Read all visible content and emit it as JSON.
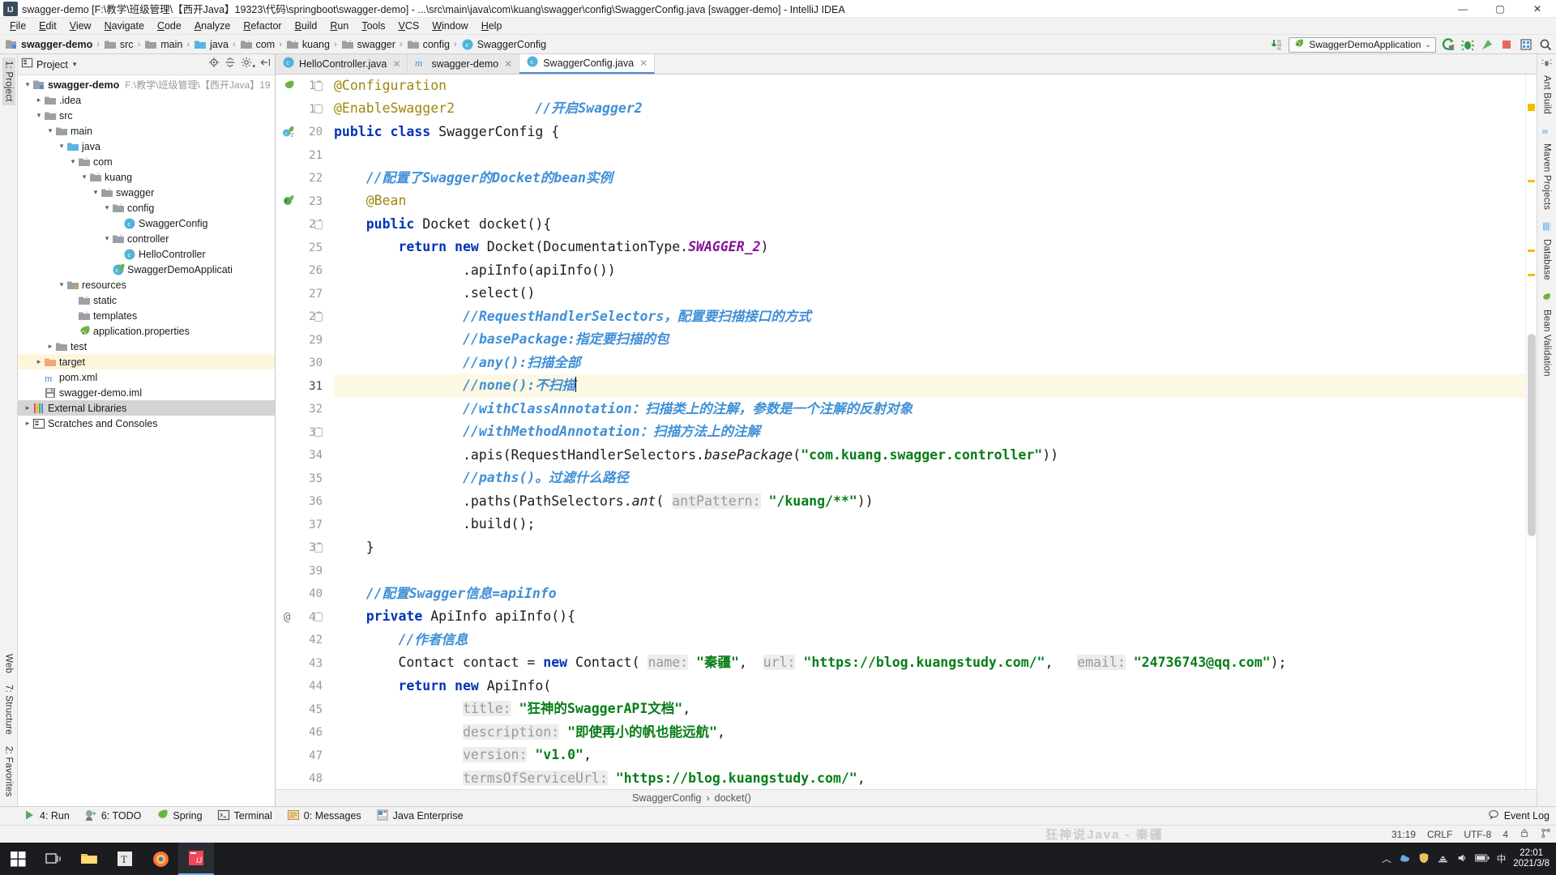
{
  "window": {
    "title": "swagger-demo [F:\\教学\\班级管理\\【西开Java】19323\\代码\\springboot\\swagger-demo] - ...\\src\\main\\java\\com\\kuang\\swagger\\config\\SwaggerConfig.java [swagger-demo] - IntelliJ IDEA",
    "app_icon": "IJ",
    "minimize": "—",
    "maximize": "▢",
    "close": "✕"
  },
  "menubar": {
    "items": [
      "File",
      "Edit",
      "View",
      "Navigate",
      "Code",
      "Analyze",
      "Refactor",
      "Build",
      "Run",
      "Tools",
      "VCS",
      "Window",
      "Help"
    ]
  },
  "navbar": {
    "breadcrumbs": [
      {
        "label": "swagger-demo",
        "icon": "module-icon",
        "bold": true
      },
      {
        "label": "src",
        "icon": "folder-icon",
        "bold": false
      },
      {
        "label": "main",
        "icon": "folder-icon",
        "bold": false
      },
      {
        "label": "java",
        "icon": "source-folder-icon",
        "bold": false
      },
      {
        "label": "com",
        "icon": "package-icon",
        "bold": false
      },
      {
        "label": "kuang",
        "icon": "package-icon",
        "bold": false
      },
      {
        "label": "swagger",
        "icon": "package-icon",
        "bold": false
      },
      {
        "label": "config",
        "icon": "package-icon",
        "bold": false
      },
      {
        "label": "SwaggerConfig",
        "icon": "class-icon",
        "bold": false
      }
    ],
    "separator": "›",
    "run_config": "SwaggerDemoApplication",
    "run_config_caret": "⌄",
    "icons": [
      "build-icon",
      "run-icon",
      "debug-icon",
      "run-coverage-icon",
      "stop-icon",
      "database-icon",
      "search-icon"
    ]
  },
  "left_stripe": {
    "top_tab": "1: Project",
    "bottom_tabs": [
      "2: Favorites",
      "7: Structure",
      "Web"
    ]
  },
  "project_panel": {
    "title": "Project",
    "title_caret": "▾",
    "header_icons": [
      "locate-icon",
      "collapse-all-icon",
      "settings-gear-icon",
      "hide-icon"
    ],
    "tree": [
      {
        "depth": 0,
        "arrow": "▾",
        "icon": "module-icon",
        "label": "swagger-demo",
        "bold": true,
        "path": "F:\\教学\\班级管理\\【西开Java】19"
      },
      {
        "depth": 1,
        "arrow": "▸",
        "icon": "folder-icon",
        "label": ".idea",
        "bold": false,
        "path": ""
      },
      {
        "depth": 1,
        "arrow": "▾",
        "icon": "folder-icon",
        "label": "src",
        "bold": false,
        "path": ""
      },
      {
        "depth": 2,
        "arrow": "▾",
        "icon": "folder-icon",
        "label": "main",
        "bold": false,
        "path": ""
      },
      {
        "depth": 3,
        "arrow": "▾",
        "icon": "source-folder-icon",
        "label": "java",
        "bold": false,
        "path": ""
      },
      {
        "depth": 4,
        "arrow": "▾",
        "icon": "package-icon",
        "label": "com",
        "bold": false,
        "path": ""
      },
      {
        "depth": 5,
        "arrow": "▾",
        "icon": "package-icon",
        "label": "kuang",
        "bold": false,
        "path": ""
      },
      {
        "depth": 6,
        "arrow": "▾",
        "icon": "package-icon",
        "label": "swagger",
        "bold": false,
        "path": ""
      },
      {
        "depth": 7,
        "arrow": "▾",
        "icon": "package-icon",
        "label": "config",
        "bold": false,
        "path": ""
      },
      {
        "depth": 8,
        "arrow": "",
        "icon": "class-icon",
        "label": "SwaggerConfig",
        "bold": false,
        "path": ""
      },
      {
        "depth": 7,
        "arrow": "▾",
        "icon": "package-icon",
        "label": "controller",
        "bold": false,
        "path": ""
      },
      {
        "depth": 8,
        "arrow": "",
        "icon": "class-icon",
        "label": "HelloController",
        "bold": false,
        "path": ""
      },
      {
        "depth": 7,
        "arrow": "",
        "icon": "spring-class-icon",
        "label": "SwaggerDemoApplicati",
        "bold": false,
        "path": ""
      },
      {
        "depth": 3,
        "arrow": "▾",
        "icon": "resources-folder-icon",
        "label": "resources",
        "bold": false,
        "path": ""
      },
      {
        "depth": 4,
        "arrow": "",
        "icon": "package-icon",
        "label": "static",
        "bold": false,
        "path": ""
      },
      {
        "depth": 4,
        "arrow": "",
        "icon": "package-icon",
        "label": "templates",
        "bold": false,
        "path": ""
      },
      {
        "depth": 4,
        "arrow": "",
        "icon": "spring-file-icon",
        "label": "application.properties",
        "bold": false,
        "path": ""
      },
      {
        "depth": 2,
        "arrow": "▸",
        "icon": "folder-icon",
        "label": "test",
        "bold": false,
        "path": ""
      },
      {
        "depth": 1,
        "arrow": "▸",
        "icon": "target-folder-icon",
        "label": "target",
        "bold": false,
        "path": "",
        "highlight": true
      },
      {
        "depth": 1,
        "arrow": "",
        "icon": "maven-icon",
        "label": "pom.xml",
        "bold": false,
        "path": ""
      },
      {
        "depth": 1,
        "arrow": "",
        "icon": "iml-icon",
        "label": "swagger-demo.iml",
        "bold": false,
        "path": ""
      },
      {
        "depth": 0,
        "arrow": "▸",
        "icon": "libraries-icon",
        "label": "External Libraries",
        "bold": false,
        "path": "",
        "selected": true
      },
      {
        "depth": 0,
        "arrow": "▸",
        "icon": "scratches-icon",
        "label": "Scratches and Consoles",
        "bold": false,
        "path": ""
      }
    ]
  },
  "editor_tabs": [
    {
      "label": "HelloController.java",
      "icon": "class-icon",
      "active": false,
      "close": "✕"
    },
    {
      "label": "swagger-demo",
      "icon": "maven-icon",
      "active": false,
      "close": "✕"
    },
    {
      "label": "SwaggerConfig.java",
      "icon": "class-icon",
      "active": true,
      "close": "✕"
    }
  ],
  "editor": {
    "first_line": 18,
    "current_line": 31,
    "lines": [
      {
        "n": 18,
        "gutter_icon": "spring-bean-icon",
        "fold": "minus",
        "tokens": [
          {
            "t": "@Configuration",
            "c": "ann"
          }
        ]
      },
      {
        "n": 19,
        "gutter_icon": "",
        "fold": "minus",
        "tokens": [
          {
            "t": "@EnableSwagger2",
            "c": "ann"
          },
          {
            "t": "          ",
            "c": "id"
          },
          {
            "t": "//开启Swagger2",
            "c": "cm"
          }
        ]
      },
      {
        "n": 20,
        "gutter_icon": "class-bean-icon",
        "fold": "",
        "tokens": [
          {
            "t": "public class ",
            "c": "k"
          },
          {
            "t": "SwaggerConfig {",
            "c": "id"
          }
        ]
      },
      {
        "n": 21,
        "gutter_icon": "",
        "fold": "",
        "tokens": []
      },
      {
        "n": 22,
        "gutter_icon": "",
        "fold": "",
        "tokens": [
          {
            "t": "    ",
            "c": "id"
          },
          {
            "t": "//配置了Swagger的Docket的bean实例",
            "c": "cm"
          }
        ]
      },
      {
        "n": 23,
        "gutter_icon": "bean-icon",
        "fold": "",
        "tokens": [
          {
            "t": "    ",
            "c": "id"
          },
          {
            "t": "@Bean",
            "c": "ann"
          }
        ]
      },
      {
        "n": 24,
        "gutter_icon": "",
        "fold": "minus",
        "tokens": [
          {
            "t": "    ",
            "c": "id"
          },
          {
            "t": "public ",
            "c": "k"
          },
          {
            "t": "Docket docket(){",
            "c": "id"
          }
        ]
      },
      {
        "n": 25,
        "gutter_icon": "",
        "fold": "",
        "tokens": [
          {
            "t": "        ",
            "c": "id"
          },
          {
            "t": "return new ",
            "c": "k"
          },
          {
            "t": "Docket(DocumentationType.",
            "c": "id"
          },
          {
            "t": "SWAGGER_2",
            "c": "cst"
          },
          {
            "t": ")",
            "c": "id"
          }
        ]
      },
      {
        "n": 26,
        "gutter_icon": "",
        "fold": "",
        "tokens": [
          {
            "t": "                .apiInfo(apiInfo())",
            "c": "id"
          }
        ]
      },
      {
        "n": 27,
        "gutter_icon": "",
        "fold": "",
        "tokens": [
          {
            "t": "                .select()",
            "c": "id"
          }
        ]
      },
      {
        "n": 28,
        "gutter_icon": "",
        "fold": "minus",
        "tokens": [
          {
            "t": "                ",
            "c": "id"
          },
          {
            "t": "//RequestHandlerSelectors，配置要扫描接口的方式",
            "c": "cm"
          }
        ]
      },
      {
        "n": 29,
        "gutter_icon": "",
        "fold": "",
        "tokens": [
          {
            "t": "                ",
            "c": "id"
          },
          {
            "t": "//basePackage:指定要扫描的包",
            "c": "cm"
          }
        ]
      },
      {
        "n": 30,
        "gutter_icon": "",
        "fold": "",
        "tokens": [
          {
            "t": "                ",
            "c": "id"
          },
          {
            "t": "//any():扫描全部",
            "c": "cm"
          }
        ]
      },
      {
        "n": 31,
        "gutter_icon": "",
        "fold": "",
        "highlight": true,
        "caret_after": true,
        "tokens": [
          {
            "t": "                ",
            "c": "id"
          },
          {
            "t": "//none():不扫描",
            "c": "cm"
          }
        ]
      },
      {
        "n": 32,
        "gutter_icon": "",
        "fold": "",
        "tokens": [
          {
            "t": "                ",
            "c": "id"
          },
          {
            "t": "//withClassAnnotation：扫描类上的注解，参数是一个注解的反射对象",
            "c": "cm"
          }
        ]
      },
      {
        "n": 33,
        "gutter_icon": "",
        "fold": "minus",
        "tokens": [
          {
            "t": "                ",
            "c": "id"
          },
          {
            "t": "//withMethodAnnotation：扫描方法上的注解",
            "c": "cm"
          }
        ]
      },
      {
        "n": 34,
        "gutter_icon": "",
        "fold": "",
        "tokens": [
          {
            "t": "                .apis(RequestHandlerSelectors.",
            "c": "id"
          },
          {
            "t": "basePackage",
            "c": "it"
          },
          {
            "t": "(",
            "c": "id"
          },
          {
            "t": "\"com.kuang.swagger.controller\"",
            "c": "st"
          },
          {
            "t": "))",
            "c": "id"
          }
        ]
      },
      {
        "n": 35,
        "gutter_icon": "",
        "fold": "",
        "tokens": [
          {
            "t": "                ",
            "c": "id"
          },
          {
            "t": "//paths()。过滤什么路径",
            "c": "cm"
          }
        ]
      },
      {
        "n": 36,
        "gutter_icon": "",
        "fold": "",
        "tokens": [
          {
            "t": "                .paths(PathSelectors.",
            "c": "id"
          },
          {
            "t": "ant",
            "c": "it"
          },
          {
            "t": "( ",
            "c": "id"
          },
          {
            "t": "antPattern:",
            "c": "hint"
          },
          {
            "t": " ",
            "c": "id"
          },
          {
            "t": "\"/kuang/**\"",
            "c": "st"
          },
          {
            "t": "))",
            "c": "id"
          }
        ]
      },
      {
        "n": 37,
        "gutter_icon": "",
        "fold": "",
        "tokens": [
          {
            "t": "                .build();",
            "c": "id"
          }
        ]
      },
      {
        "n": 38,
        "gutter_icon": "",
        "fold": "minus",
        "tokens": [
          {
            "t": "    }",
            "c": "id"
          }
        ]
      },
      {
        "n": 39,
        "gutter_icon": "",
        "fold": "",
        "tokens": []
      },
      {
        "n": 40,
        "gutter_icon": "",
        "fold": "",
        "tokens": [
          {
            "t": "    ",
            "c": "id"
          },
          {
            "t": "//配置Swagger信息=apiInfo",
            "c": "cm"
          }
        ]
      },
      {
        "n": 41,
        "gutter_icon": "at-icon",
        "fold": "minus",
        "tokens": [
          {
            "t": "    ",
            "c": "id"
          },
          {
            "t": "private ",
            "c": "k"
          },
          {
            "t": "ApiInfo apiInfo(){",
            "c": "id"
          }
        ]
      },
      {
        "n": 42,
        "gutter_icon": "",
        "fold": "",
        "tokens": [
          {
            "t": "        ",
            "c": "id"
          },
          {
            "t": "//作者信息",
            "c": "cm"
          }
        ]
      },
      {
        "n": 43,
        "gutter_icon": "",
        "fold": "",
        "tokens": [
          {
            "t": "        Contact contact = ",
            "c": "id"
          },
          {
            "t": "new ",
            "c": "k"
          },
          {
            "t": "Contact( ",
            "c": "id"
          },
          {
            "t": "name:",
            "c": "hint"
          },
          {
            "t": " ",
            "c": "id"
          },
          {
            "t": "\"秦疆\"",
            "c": "st"
          },
          {
            "t": ",  ",
            "c": "id"
          },
          {
            "t": "url:",
            "c": "hint"
          },
          {
            "t": " ",
            "c": "id"
          },
          {
            "t": "\"https://blog.kuangstudy.com/\"",
            "c": "st"
          },
          {
            "t": ",   ",
            "c": "id"
          },
          {
            "t": "email:",
            "c": "hint"
          },
          {
            "t": " ",
            "c": "id"
          },
          {
            "t": "\"24736743@qq.com\"",
            "c": "st"
          },
          {
            "t": ");",
            "c": "id"
          }
        ]
      },
      {
        "n": 44,
        "gutter_icon": "",
        "fold": "",
        "tokens": [
          {
            "t": "        ",
            "c": "id"
          },
          {
            "t": "return new ",
            "c": "k"
          },
          {
            "t": "ApiInfo(",
            "c": "id"
          }
        ]
      },
      {
        "n": 45,
        "gutter_icon": "",
        "fold": "",
        "tokens": [
          {
            "t": "                ",
            "c": "id"
          },
          {
            "t": "title:",
            "c": "hint"
          },
          {
            "t": " ",
            "c": "id"
          },
          {
            "t": "\"狂神的SwaggerAPI文档\"",
            "c": "st"
          },
          {
            "t": ",",
            "c": "id"
          }
        ]
      },
      {
        "n": 46,
        "gutter_icon": "",
        "fold": "",
        "tokens": [
          {
            "t": "                ",
            "c": "id"
          },
          {
            "t": "description:",
            "c": "hint"
          },
          {
            "t": " ",
            "c": "id"
          },
          {
            "t": "\"即使再小的帆也能远航\"",
            "c": "st"
          },
          {
            "t": ",",
            "c": "id"
          }
        ]
      },
      {
        "n": 47,
        "gutter_icon": "",
        "fold": "",
        "tokens": [
          {
            "t": "                ",
            "c": "id"
          },
          {
            "t": "version:",
            "c": "hint"
          },
          {
            "t": " ",
            "c": "id"
          },
          {
            "t": "\"v1.0\"",
            "c": "st"
          },
          {
            "t": ",",
            "c": "id"
          }
        ]
      },
      {
        "n": 48,
        "gutter_icon": "",
        "fold": "",
        "tokens": [
          {
            "t": "                ",
            "c": "id"
          },
          {
            "t": "termsOfServiceUrl:",
            "c": "hint"
          },
          {
            "t": " ",
            "c": "id"
          },
          {
            "t": "\"https://blog.kuangstudy.com/\"",
            "c": "st"
          },
          {
            "t": ",",
            "c": "id"
          }
        ]
      }
    ],
    "breadcrumb": [
      "SwaggerConfig",
      "docket()"
    ],
    "breadcrumb_sep": "›"
  },
  "right_stripe": {
    "tabs": [
      "Ant Build",
      "Maven Projects",
      "Database",
      "Bean Validation"
    ]
  },
  "bottom_toolbar": {
    "items": [
      {
        "label": "4: Run",
        "icon": "run-icon",
        "mnemonic": "4"
      },
      {
        "label": "6: TODO",
        "icon": "todo-icon",
        "mnemonic": "6"
      },
      {
        "label": "Spring",
        "icon": "spring-icon",
        "mnemonic": ""
      },
      {
        "label": "Terminal",
        "icon": "terminal-icon",
        "mnemonic": ""
      },
      {
        "label": "0: Messages",
        "icon": "messages-icon",
        "mnemonic": "0"
      },
      {
        "label": "Java Enterprise",
        "icon": "java-ee-icon",
        "mnemonic": ""
      }
    ],
    "event_log": "Event Log",
    "event_log_icon": "event-log-icon"
  },
  "statusbar": {
    "watermark": "狂神说Java - 秦疆",
    "caret_position": "31:19",
    "line_separator": "CRLF",
    "encoding": "UTF-8",
    "indent": "4",
    "lock_icon": "lock-icon",
    "branch_icon": "git-branch-icon"
  },
  "taskbar": {
    "items": [
      {
        "icon": "windows-start-icon",
        "active": false
      },
      {
        "icon": "task-view-icon",
        "active": false
      },
      {
        "icon": "file-explorer-icon",
        "active": false
      },
      {
        "icon": "typora-icon",
        "active": false
      },
      {
        "icon": "firefox-icon",
        "active": false
      },
      {
        "icon": "intellij-idea-icon",
        "active": true
      }
    ],
    "tray_icons": [
      "chevron-up-icon",
      "network-icon",
      "battery-icon",
      "speaker-icon",
      "cloud-icon",
      "shield-icon"
    ],
    "ime": "中",
    "clock_time": "22:01",
    "clock_date": "2021/3/8"
  },
  "colors": {
    "accent": "#4c8ecf",
    "comment": "#3f8fd6",
    "keyword": "#0033b3",
    "string": "#067d17",
    "annotation": "#9e880d",
    "constant": "#871094",
    "highlight_row": "#fdf8e3",
    "panel_bg": "#f2f2f2",
    "editor_bg": "#ffffff"
  }
}
